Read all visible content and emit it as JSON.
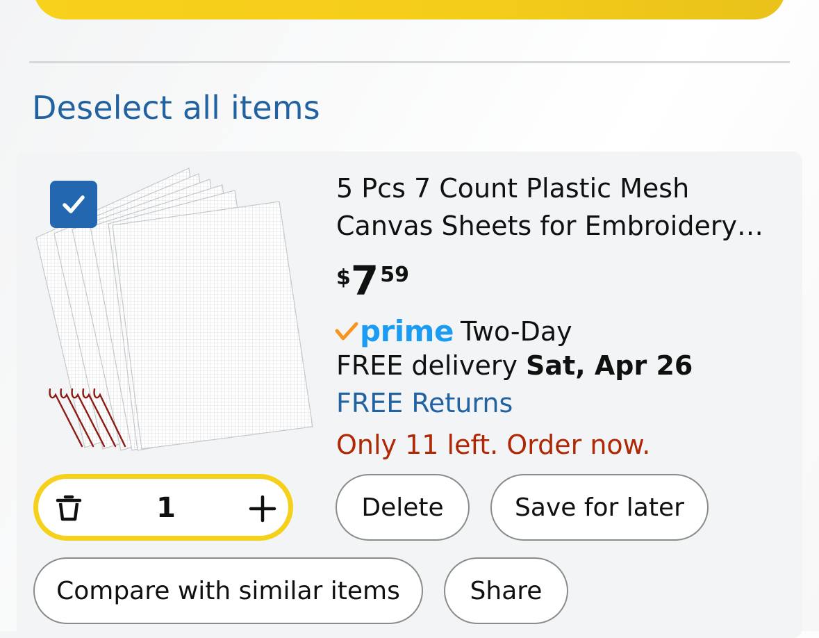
{
  "top_button": {
    "label": ""
  },
  "cart": {
    "deselect_label": "Deselect all items",
    "item": {
      "selected": true,
      "title_line1": "5 Pcs 7 Count Plastic Mesh",
      "title_line2": "Canvas Sheets for Embroidery…",
      "price": {
        "currency": "$",
        "whole": "7",
        "fraction": "59"
      },
      "prime": {
        "check": "✓",
        "label": "prime",
        "shipping": "Two-Day"
      },
      "delivery": {
        "prefix": "FREE delivery",
        "date": "Sat, Apr 26"
      },
      "returns": "FREE Returns",
      "stock": "Only 11 left. Order now.",
      "quantity": "1",
      "actions": {
        "delete": "Delete",
        "save_for_later": "Save for later",
        "compare": "Compare with similar items",
        "share": "Share"
      }
    }
  },
  "colors": {
    "accent_yellow": "#f6d11c",
    "link_blue": "#2162a1",
    "prime_blue": "#1b9cf2",
    "prime_check": "#f7931e",
    "stock_red": "#b12704",
    "checkbox_blue": "#2267b0"
  },
  "icons": {
    "checkbox": "checkmark-icon",
    "quantity_decrease": "trash-icon",
    "quantity_increase": "plus-icon",
    "prime": "prime-check-icon"
  }
}
